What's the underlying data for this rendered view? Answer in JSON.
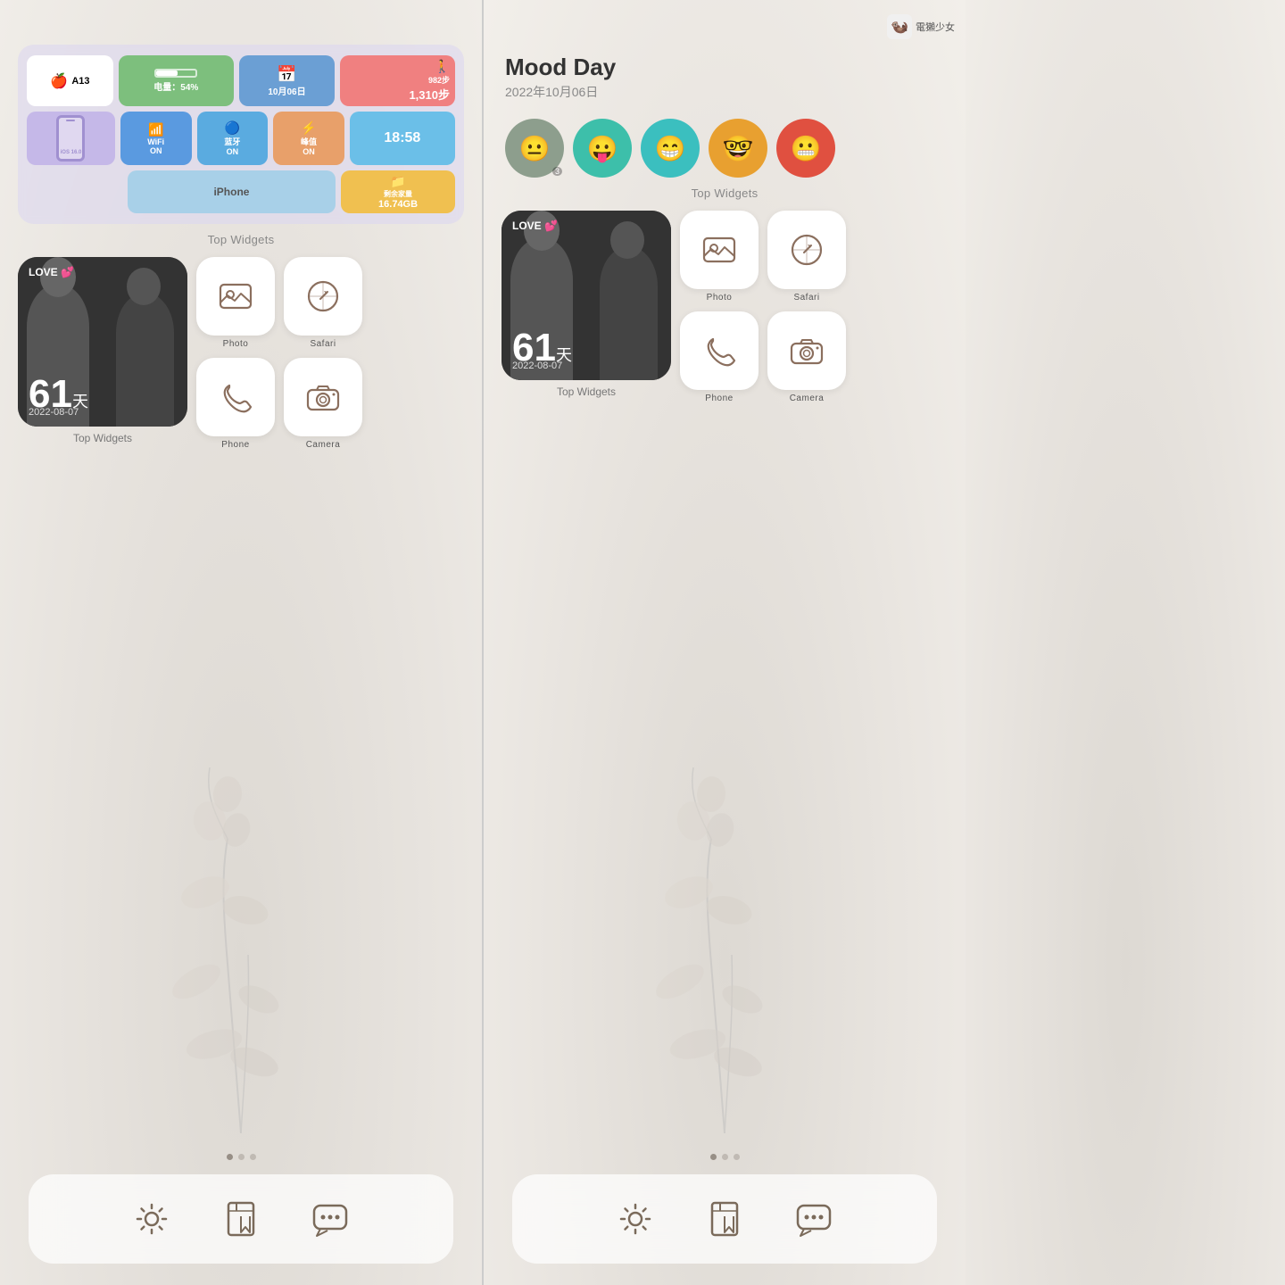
{
  "left_screen": {
    "widget_info": {
      "chip": "A13",
      "battery_label": "电量：54%",
      "battery_pct": 54,
      "date_label": "10月06日",
      "steps_line1": "982步",
      "steps_line2": "1,310步",
      "wifi_label": "WiFi",
      "wifi_sub": "ON",
      "bt_label": "蓝牙",
      "bt_sub": "ON",
      "peak_label": "峰值",
      "peak_sub": "ON",
      "time_label": "18:58",
      "iphone_name": "iPhone",
      "ios_version": "iOS 16.0",
      "storage_line1": "剩余家量",
      "storage_line2": "16.74GB"
    },
    "section_label": "Top Widgets",
    "love_widget": {
      "title": "LOVE 💕",
      "days": "61",
      "unit": "天",
      "date": "2022-08-07",
      "label": "Top Widgets"
    },
    "apps": [
      {
        "id": "photo",
        "label": "Photo",
        "icon": "photo"
      },
      {
        "id": "safari",
        "label": "Safari",
        "icon": "safari"
      },
      {
        "id": "phone",
        "label": "Phone",
        "icon": "phone"
      },
      {
        "id": "camera",
        "label": "Camera",
        "icon": "camera"
      }
    ],
    "dots": [
      true,
      false,
      false
    ],
    "dock": [
      {
        "id": "settings",
        "icon": "settings"
      },
      {
        "id": "notebook",
        "icon": "notebook"
      },
      {
        "id": "chat",
        "icon": "chat"
      }
    ]
  },
  "right_screen": {
    "watermark": "電獺少女",
    "mood_title": "Mood Day",
    "mood_date": "2022年10月06日",
    "mood_emojis": [
      {
        "color": "#8d9e8d",
        "emoji": "😐",
        "count": "3"
      },
      {
        "color": "#3dbfaa",
        "emoji": "😛",
        "count": ""
      },
      {
        "color": "#3bbfbf",
        "emoji": "😁",
        "count": ""
      },
      {
        "color": "#e8a030",
        "emoji": "🤓",
        "count": ""
      },
      {
        "color": "#e05040",
        "emoji": "😬",
        "count": ""
      }
    ],
    "section_label": "Top Widgets",
    "love_widget": {
      "title": "LOVE 💕",
      "days": "61",
      "unit": "天",
      "date": "2022-08-07",
      "label": "Top Widgets"
    },
    "apps": [
      {
        "id": "photo",
        "label": "Photo",
        "icon": "photo"
      },
      {
        "id": "safari",
        "label": "Safari",
        "icon": "safari"
      },
      {
        "id": "phone",
        "label": "Phone",
        "icon": "phone"
      },
      {
        "id": "camera",
        "label": "Camera",
        "icon": "camera"
      }
    ],
    "dots": [
      true,
      false,
      false
    ],
    "dock": [
      {
        "id": "settings",
        "icon": "settings"
      },
      {
        "id": "notebook",
        "icon": "notebook"
      },
      {
        "id": "chat",
        "icon": "chat"
      }
    ]
  },
  "icons": {
    "photo": "🖼",
    "safari": "🧭",
    "phone": "📞",
    "camera": "📸",
    "settings": "⚙",
    "notebook": "📒",
    "chat": "💬"
  }
}
